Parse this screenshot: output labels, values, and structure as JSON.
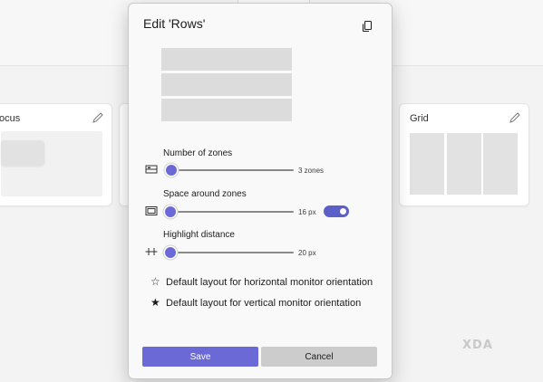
{
  "background": {
    "cards": [
      {
        "title": "ocus"
      },
      {
        "title": "Grid"
      }
    ]
  },
  "dialog": {
    "title": "Edit 'Rows'",
    "icons": {
      "copy": "copy-icon"
    },
    "preview": {
      "zone_count": 3
    },
    "settings": [
      {
        "label": "Number of zones",
        "value": "3 zones",
        "level": 0.05,
        "icon": "zones-count-icon"
      },
      {
        "label": "Space around zones",
        "value": "16 px",
        "level": 0.04,
        "icon": "zone-spacing-icon",
        "toggle_on": true
      },
      {
        "label": "Highlight distance",
        "value": "20 px",
        "level": 0.04,
        "icon": "highlight-distance-icon"
      }
    ],
    "layout_defaults": [
      {
        "label": "Default layout for horizontal monitor orientation",
        "star": "☆",
        "icon": "star-outline-icon"
      },
      {
        "label": "Default layout for vertical monitor orientation",
        "star": "★",
        "icon": "star-filled-icon"
      }
    ],
    "buttons": {
      "save": "Save",
      "cancel": "Cancel"
    }
  },
  "colors": {
    "accent": "#6b69d6",
    "toggle": "#5b5fc7",
    "zone": "#dcdcdc"
  },
  "watermark": "XDA"
}
